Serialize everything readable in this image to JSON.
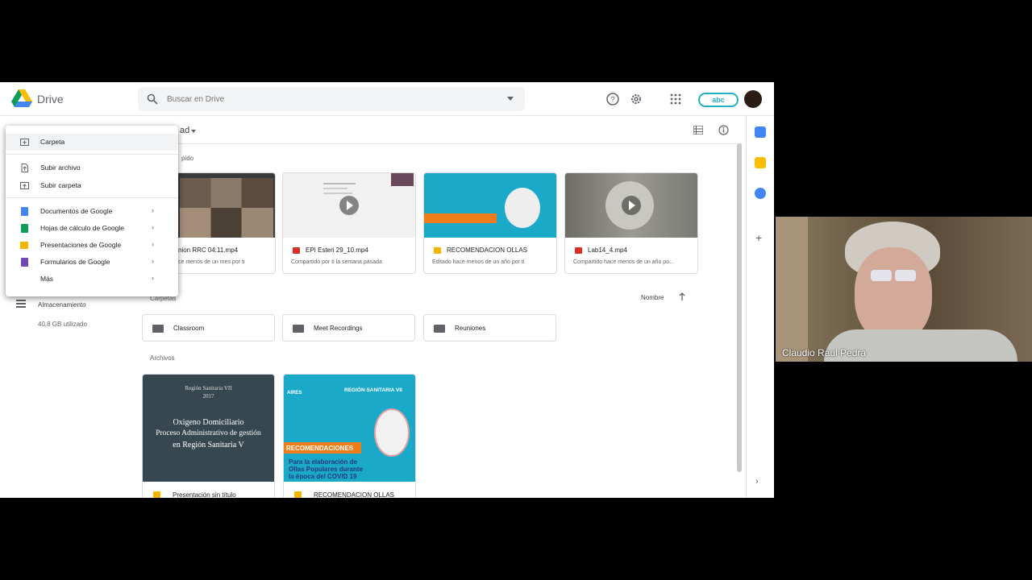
{
  "app": {
    "name": "Drive"
  },
  "search": {
    "placeholder": "Buscar en Drive"
  },
  "account": {
    "badge": "abc"
  },
  "header": {
    "title_partial": "ad"
  },
  "quick_access": {
    "label_partial": "pido",
    "cards": [
      {
        "name": "nion RRC 04:11.mp4",
        "sub": "ce menos de un mes por ti",
        "type": "video"
      },
      {
        "name": "EPI Esteri 29_10.mp4",
        "sub": "Compartido por ti la semana pasada",
        "type": "video"
      },
      {
        "name": "RECOMENDACION OLLAS",
        "sub": "Editado hace menos de un año por ti",
        "type": "slides"
      },
      {
        "name": "Lab14_4.mp4",
        "sub": "Compartido hace menos de un año po...",
        "type": "video"
      }
    ]
  },
  "folders": {
    "label": "Carpetas",
    "sort_label": "Nombre",
    "items": [
      "Classroom",
      "Meet Recordings",
      "Reuniones"
    ]
  },
  "files": {
    "label": "Archivos",
    "items": [
      {
        "name": "Presentación sin título",
        "thumb_lines": [
          "Región Sanitaria VII",
          "2017",
          "Oxigeno Domiciliario",
          "Proceso Administrativo de gestión",
          "en Región Sanitaria V"
        ]
      },
      {
        "name": "RECOMENDACION OLLAS",
        "thumb_lines": [
          "REGIÓN SANITARIA VII",
          "RECOMENDACIONES",
          "Para la elaboración de",
          "Ollas Populares durante",
          "la época del COVID 19",
          "AIRES"
        ]
      }
    ]
  },
  "sidebar": {
    "storage_label": "Almacenamiento",
    "storage_used": "40,8 GB utilizado"
  },
  "new_menu": {
    "items": [
      {
        "label": "Carpeta",
        "icon": "folder-plus-icon",
        "has_submenu": false
      },
      {
        "label": "Subir archivo",
        "icon": "file-upload-icon",
        "has_submenu": false
      },
      {
        "label": "Subir carpeta",
        "icon": "folder-upload-icon",
        "has_submenu": false
      },
      {
        "label": "Documentos de Google",
        "icon": "docs-icon",
        "has_submenu": true
      },
      {
        "label": "Hojas de cálculo de Google",
        "icon": "sheets-icon",
        "has_submenu": true
      },
      {
        "label": "Presentaciones de Google",
        "icon": "slides-icon",
        "has_submenu": true
      },
      {
        "label": "Formularios de Google",
        "icon": "forms-icon",
        "has_submenu": true
      },
      {
        "label": "Más",
        "icon": "none",
        "has_submenu": true
      }
    ],
    "chevron": "›"
  },
  "video_call": {
    "participant_name": "Claudio Raul Pedra"
  },
  "colors": {
    "docs": "#4285f4",
    "sheets": "#0f9d58",
    "slides": "#f4b400",
    "forms": "#7248b9",
    "video": "#d93025",
    "accent": "#1a73e8"
  },
  "misc": {
    "next_arrow": "›"
  }
}
